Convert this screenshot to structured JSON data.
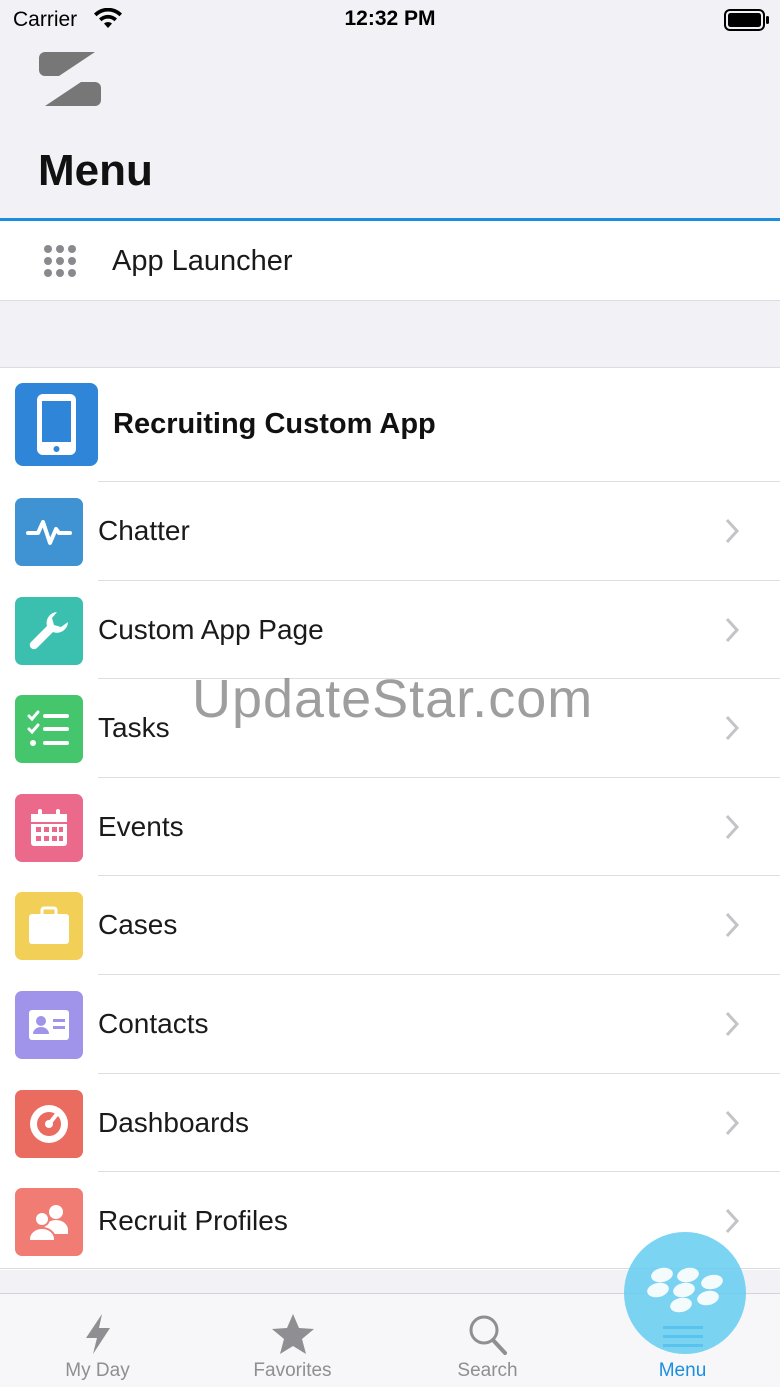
{
  "status_bar": {
    "carrier": "Carrier",
    "time": "12:32 PM"
  },
  "header": {
    "title": "Menu"
  },
  "launcher": {
    "label": "App Launcher"
  },
  "app": {
    "title": "Recruiting Custom App",
    "color": "#2f86d8"
  },
  "items": [
    {
      "label": "Chatter",
      "color": "#3f93d2",
      "icon": "pulse-icon"
    },
    {
      "label": "Custom App Page",
      "color": "#3bc0b0",
      "icon": "wrench-icon"
    },
    {
      "label": "Tasks",
      "color": "#45c56c",
      "icon": "checklist-icon"
    },
    {
      "label": "Events",
      "color": "#eb6a8c",
      "icon": "calendar-icon"
    },
    {
      "label": "Cases",
      "color": "#f2cf56",
      "icon": "briefcase-icon"
    },
    {
      "label": "Contacts",
      "color": "#a094ea",
      "icon": "contact-card-icon"
    },
    {
      "label": "Dashboards",
      "color": "#ea6b5f",
      "icon": "gauge-icon"
    },
    {
      "label": "Recruit Profiles",
      "color": "#f07c74",
      "icon": "people-icon"
    }
  ],
  "watermark": "UpdateStar.com",
  "tabs": [
    {
      "label": "My Day",
      "icon": "lightning-icon"
    },
    {
      "label": "Favorites",
      "icon": "star-icon"
    },
    {
      "label": "Search",
      "icon": "search-icon"
    },
    {
      "label": "Menu",
      "icon": "menu-icon",
      "active": true
    }
  ],
  "accent_color": "#1b8ee0"
}
